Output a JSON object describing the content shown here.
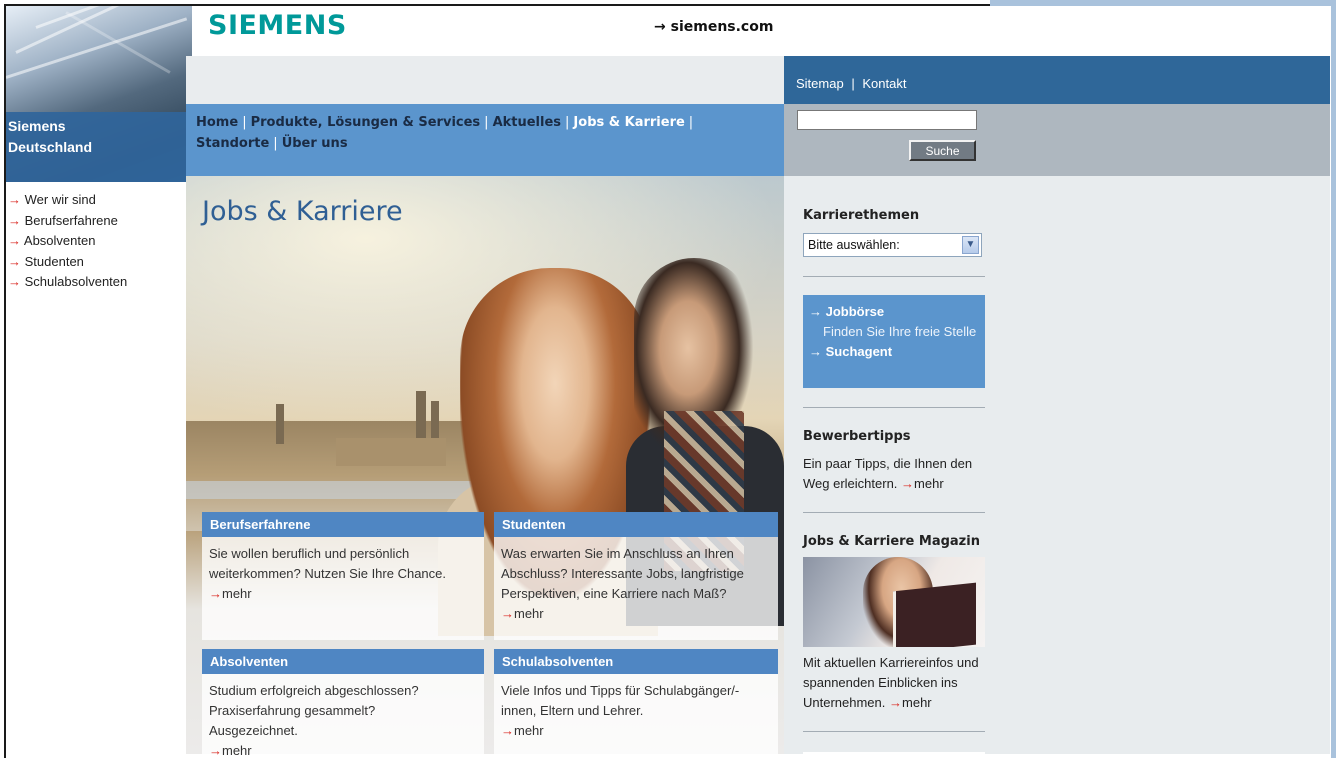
{
  "header": {
    "logo": "SIEMENS",
    "site_link": "→ siemens.com",
    "brand_sub_line1": "Siemens",
    "brand_sub_line2": "Deutschland"
  },
  "top_links": {
    "sitemap": "Sitemap",
    "separator": "|",
    "kontakt": "Kontakt"
  },
  "search": {
    "value": "",
    "button": "Suche"
  },
  "nav": {
    "items": [
      {
        "label": "Home"
      },
      {
        "label": "Produkte, Lösungen & Services"
      },
      {
        "label": "Aktuelles"
      },
      {
        "label": "Jobs & Karriere",
        "active": true
      },
      {
        "label": "Standorte"
      },
      {
        "label": "Über uns"
      }
    ],
    "separator": "|"
  },
  "left_nav": {
    "arrow": "→",
    "items": [
      {
        "label": "Wer wir sind"
      },
      {
        "label": "Berufserfahrene"
      },
      {
        "label": "Absolventen"
      },
      {
        "label": "Studenten"
      },
      {
        "label": "Schulabsolventen"
      }
    ]
  },
  "hero": {
    "title": "Jobs & Karriere"
  },
  "boxes": [
    {
      "title": "Berufserfahrene",
      "text": "Sie wollen beruflich und persönlich weiterkommen? Nutzen Sie Ihre Chance.",
      "more": "mehr"
    },
    {
      "title": "Studenten",
      "text": "Was erwarten Sie im Anschluss an Ihren Abschluss? Interessante Jobs, langfristige Perspektiven, eine Karriere nach Maß?",
      "more": "mehr"
    },
    {
      "title": "Absolventen",
      "text": "Studium erfolgreich abgeschlossen? Praxiserfahrung gesammelt? Ausgezeichnet.",
      "more": "mehr"
    },
    {
      "title": "Schulabsolventen",
      "text": "Viele Infos und Tipps für Schulabgänger/-innen, Eltern und Lehrer.",
      "more": "mehr"
    }
  ],
  "sidebar": {
    "karrierethemen_title": "Karrierethemen",
    "select_value": "Bitte auswählen:",
    "jobboerse": "→ Jobbörse",
    "jobboerse_sub": "Finden Sie Ihre freie Stelle",
    "suchagent": "→ Suchagent",
    "bewerbertipps_title": "Bewerbertipps",
    "bewerbertipps_text": "Ein paar Tipps, die Ihnen den Weg erleichtern.",
    "magazin_title": "Jobs & Karriere Magazin",
    "magazin_text": "Mit aktuellen Karriereinfos und spannenden Einblicken ins Unternehmen.",
    "more": "mehr",
    "arrow": "→"
  }
}
